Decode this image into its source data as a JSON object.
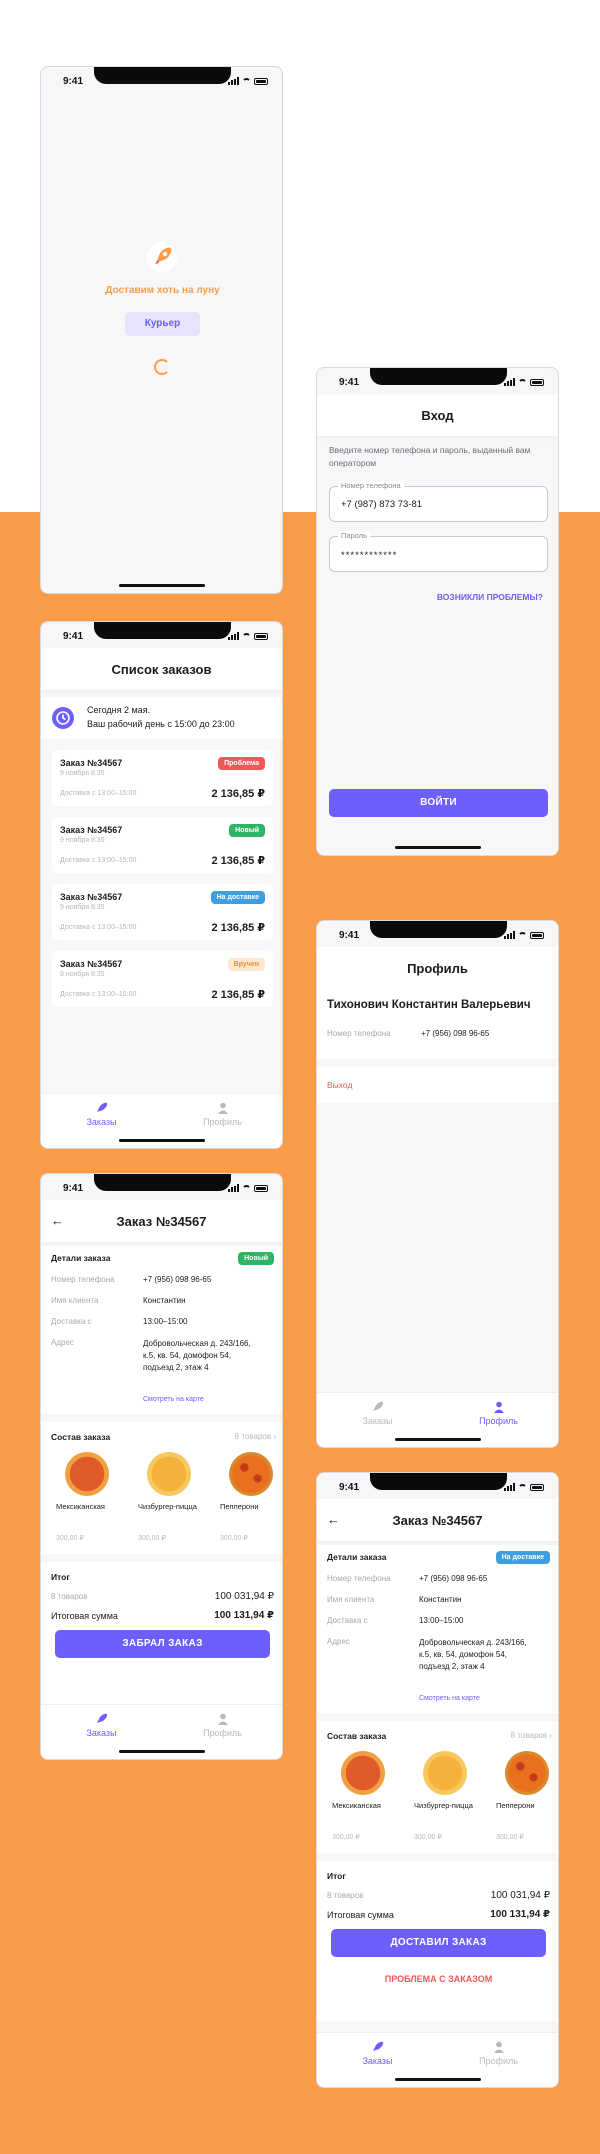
{
  "status_time": "9:41",
  "splash": {
    "tagline": "Доставим хоть на луну",
    "role_chip": "Курьер",
    "rocket_icon": "rocket-icon"
  },
  "login": {
    "title": "Вход",
    "hint": "Введите номер телефона и пароль, выданный вам оператором",
    "phone_label": "Номер телефона",
    "phone_value": "+7 (987) 873 73-81",
    "password_label": "Пароль",
    "password_value": "************",
    "problems_link": "ВОЗНИКЛИ ПРОБЛЕМЫ?",
    "submit": "ВОЙТИ"
  },
  "orders": {
    "title": "Список заказов",
    "today_line1": "Сегодня 2 мая.",
    "today_line2": "Ваш рабочий день с 15:00 до 23:00",
    "items": [
      {
        "title": "Заказ №34567",
        "date": "9 ноября 8:35",
        "slot": "Доставка с 13:00–15:00",
        "price": "2 136,85 ₽",
        "status": "Проблема"
      },
      {
        "title": "Заказ №34567",
        "date": "9 ноября 8:35",
        "slot": "Доставка с 13:00–15:00",
        "price": "2 136,85 ₽",
        "status": "Новый"
      },
      {
        "title": "Заказ №34567",
        "date": "9 ноября 8:35",
        "slot": "Доставка с 13:00–15:00",
        "price": "2 136,85 ₽",
        "status": "На доставке"
      },
      {
        "title": "Заказ №34567",
        "date": "9 ноября 8:35",
        "slot": "Доставка с 13:00–15:00",
        "price": "2 136,85 ₽",
        "status": "Вручен"
      }
    ]
  },
  "colors": {
    "accent": "#6c5ffc",
    "orange": "#fa9c4a",
    "problem": "#f0575a",
    "new": "#2fb466",
    "delivery": "#3d9fe0",
    "delivered_bg": "#fde7cf",
    "delivered_fg": "#e9903a"
  },
  "tabs": {
    "orders": "Заказы",
    "profile": "Профиль"
  },
  "profile": {
    "title": "Профиль",
    "name": "Тихонович Константин Валерьевич",
    "phone_label": "Номер телефона",
    "phone_value": "+7 (956) 098 96-65",
    "logout": "Выход"
  },
  "detail": {
    "title": "Заказ №34567",
    "section_details": "Детали заказа",
    "badge_new": "Новый",
    "badge_delivery": "На доставке",
    "phone_label": "Номер телефона",
    "phone_value": "+7 (956) 098 96-65",
    "client_label": "Имя клиента",
    "client_value": "Константин",
    "slot_label": "Доставка с",
    "slot_value": "13:00–15:00",
    "address_label": "Адрес",
    "address_value": "Добровольческая д. 243/166, к.5, кв. 54, домофон 54, подъезд 2, этаж 4",
    "map_link": "Смотреть на карте",
    "section_items": "Состав заказа",
    "items_count": "8 товаров",
    "products": [
      {
        "name": "Мексиканская",
        "price": "300,00 ₽"
      },
      {
        "name": "Чизбургер-пицца",
        "price": "300,00 ₽"
      },
      {
        "name": "Пепперони",
        "price": "300,00 ₽"
      }
    ],
    "total_title": "Итог",
    "subtotal_label": "8 товаров",
    "subtotal_value": "100 031,94 ₽",
    "total_label": "Итоговая сумма",
    "total_value": "100 131,94 ₽",
    "btn_picked": "ЗАБРАЛ ЗАКАЗ",
    "btn_delivered": "ДОСТАВИЛ ЗАКАЗ",
    "btn_problem": "ПРОБЛЕМА С ЗАКАЗОМ"
  }
}
